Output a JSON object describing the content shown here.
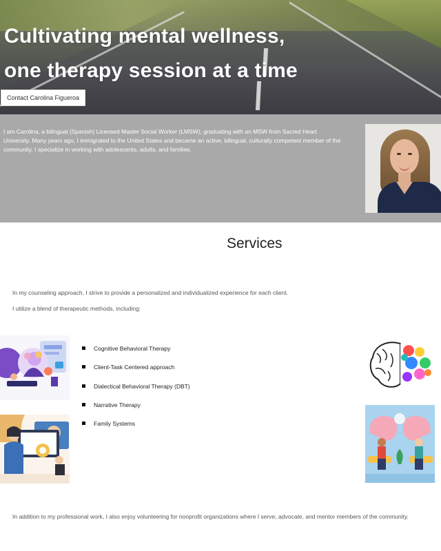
{
  "hero": {
    "title_line1": "Cultivating mental wellness,",
    "title_line2": "one therapy session at a time",
    "contact_button": "Contact Carolina Figueroa"
  },
  "about": {
    "text": "I am Carolina, a bilingual (Spanish) Licensed Master Social Worker (LMSW), graduating with an MSW from Sacred Heart University. Many years ago, I immigrated to the United States and became an active, bilingual, culturally competent member of the community. I specialize in working with adolescents, adults, and families."
  },
  "services": {
    "title": "Services",
    "intro1": "In my counseling approach, I strive to provide a personalized and individualized experience for each client.",
    "intro2": "I utilize a blend of therapeutic methods, including:",
    "methods": [
      "Cognitive Behavioral Therapy",
      "Client-Task Centered approach",
      "Dialectical Behavioral Therapy (DBT)",
      "Narrative Therapy",
      "Family Systems"
    ],
    "outro": "In addition to my professional work, I also enjoy volunteering for nonprofit organizations where I serve, advocate, and mentor members of the community."
  },
  "colors": {
    "about_bg": "#a9a9a9",
    "session_bg": "#a9d3ee"
  },
  "icons": {
    "hero": "road-photo",
    "portrait": "therapist-portrait",
    "ill1": "mind-illustration",
    "ill2": "online-session-illustration",
    "ill3": "colorful-brain-illustration",
    "ill4": "therapy-session-illustration"
  }
}
